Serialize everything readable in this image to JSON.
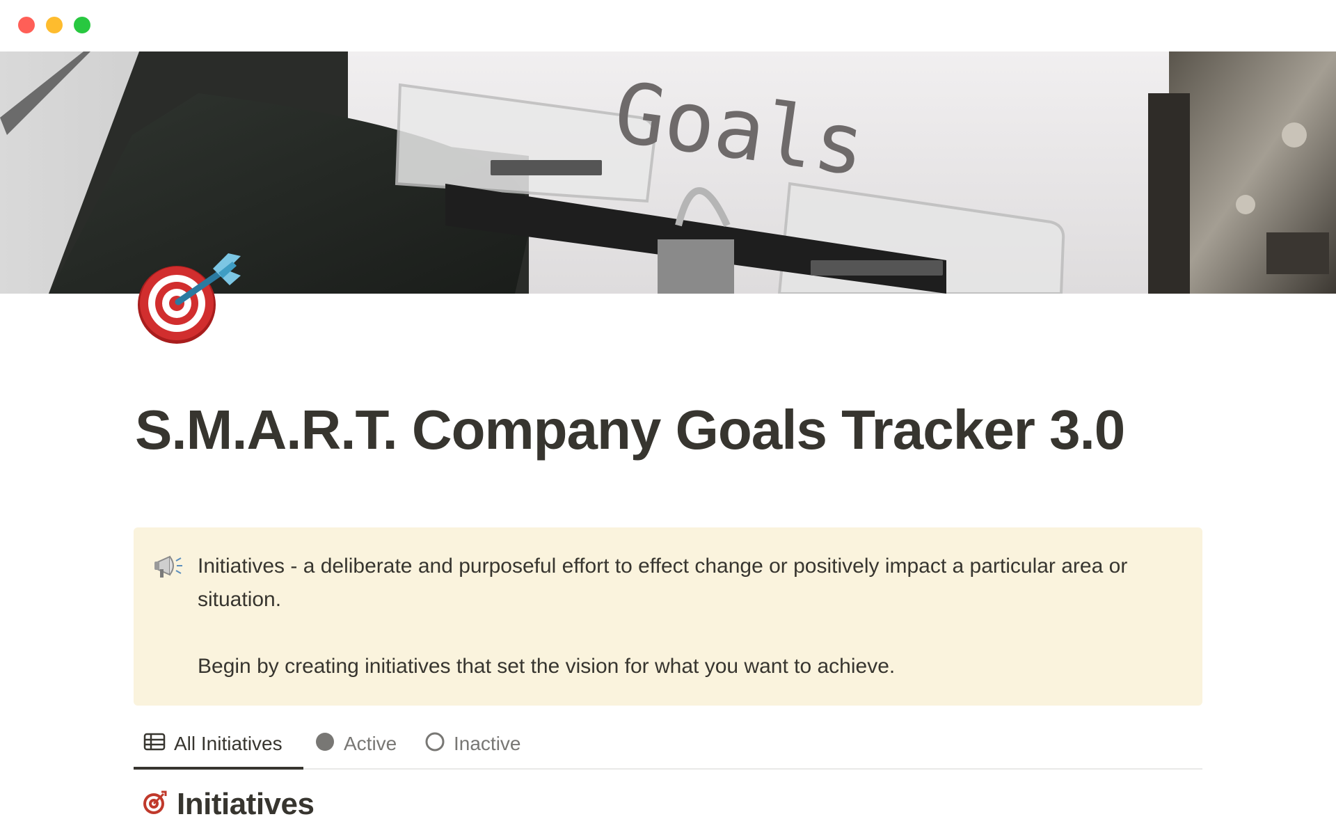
{
  "window": {
    "controls": [
      "close",
      "minimize",
      "maximize"
    ]
  },
  "cover": {
    "typed_text": "Goals"
  },
  "page": {
    "icon": "target-dart-icon",
    "title": "S.M.A.R.T. Company Goals Tracker 3.0"
  },
  "callout": {
    "icon": "megaphone-icon",
    "background": "#faf3dd",
    "paragraph_1": "Initiatives - a deliberate and purposeful effort to effect change or positively impact a particular area or situation.",
    "paragraph_2": "Begin by creating initiatives that set the vision for what you want to achieve."
  },
  "tabs": [
    {
      "label": "All Initiatives",
      "icon": "table-icon",
      "selected": true
    },
    {
      "label": "Active",
      "icon": "filled-circle-icon",
      "selected": false
    },
    {
      "label": "Inactive",
      "icon": "empty-circle-icon",
      "selected": false
    }
  ],
  "database": {
    "icon": "target-icon",
    "title": "Initiatives"
  }
}
